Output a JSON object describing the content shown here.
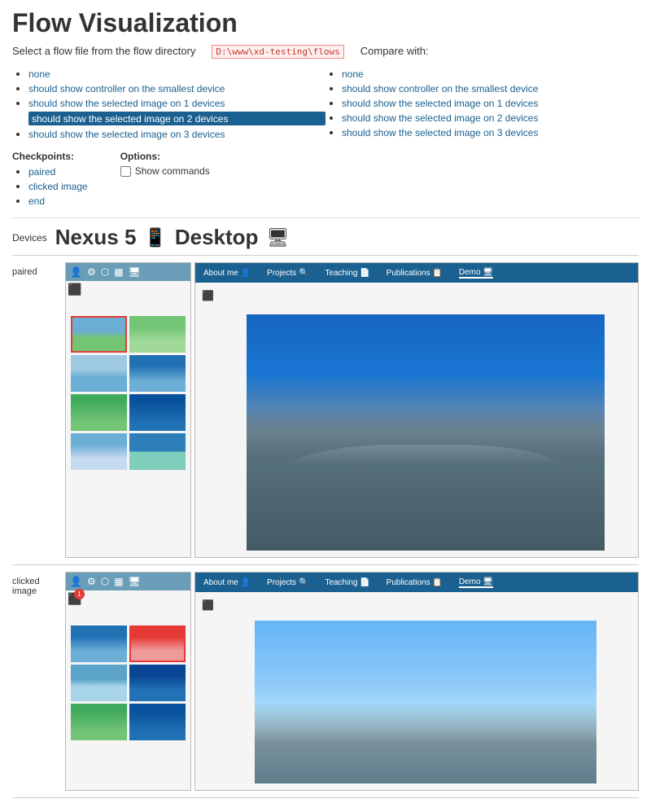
{
  "title": "Flow Visualization",
  "select_label": "Select a flow file from the flow directory",
  "folder_path": "D:\\www\\xd-testing\\flows",
  "compare_with_label": "Compare with:",
  "flow_items": [
    {
      "label": "none",
      "selected": false
    },
    {
      "label": "should show controller on the smallest device",
      "selected": false
    },
    {
      "label": "should show the selected image on 1 devices",
      "selected": false
    },
    {
      "label": "should show the selected image on 2 devices",
      "selected": true
    },
    {
      "label": "should show the selected image on 3 devices",
      "selected": false
    }
  ],
  "compare_items": [
    {
      "label": "none",
      "selected": false
    },
    {
      "label": "should show controller on the smallest device",
      "selected": false
    },
    {
      "label": "should show the selected image on 1 devices",
      "selected": false
    },
    {
      "label": "should show the selected image on 2 devices",
      "selected": false
    },
    {
      "label": "should show the selected image on 3 devices",
      "selected": false
    }
  ],
  "checkpoints_label": "Checkpoints:",
  "options_label": "Options:",
  "checkpoints": [
    {
      "label": "paired"
    },
    {
      "label": "clicked image"
    },
    {
      "label": "end"
    }
  ],
  "show_commands_label": "Show commands",
  "devices_label": "Devices",
  "device1_name": "Nexus 5",
  "device2_name": "Desktop",
  "checkpoint1_label": "paired",
  "checkpoint2_label": "clicked image",
  "nav_items": [
    "About me",
    "Projects",
    "Teaching",
    "Publications",
    "Demo"
  ],
  "active_nav": "Demo"
}
